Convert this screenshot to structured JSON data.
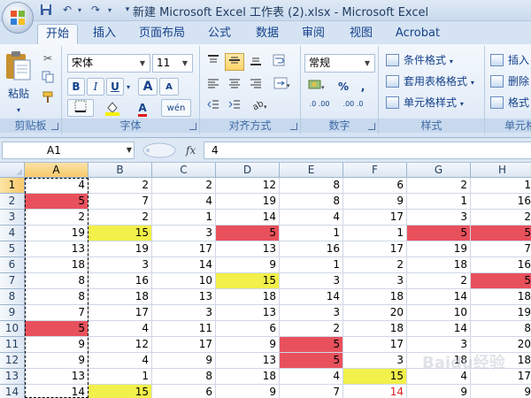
{
  "window": {
    "title": "新建 Microsoft Excel 工作表 (2).xlsx - Microsoft Excel"
  },
  "tabs": [
    {
      "label": "开始",
      "active": true
    },
    {
      "label": "插入",
      "active": false
    },
    {
      "label": "页面布局",
      "active": false
    },
    {
      "label": "公式",
      "active": false
    },
    {
      "label": "数据",
      "active": false
    },
    {
      "label": "审阅",
      "active": false
    },
    {
      "label": "视图",
      "active": false
    },
    {
      "label": "Acrobat",
      "active": false
    }
  ],
  "ribbon": {
    "clipboard": {
      "paste_label": "粘贴",
      "group_label": "剪贴板"
    },
    "font": {
      "font_name": "宋体",
      "font_size": "11",
      "bold": "B",
      "italic": "I",
      "underline": "U",
      "grow": "A",
      "shrink": "A",
      "font_color_glyph": "A",
      "phonetic": "wén",
      "group_label": "字体"
    },
    "alignment": {
      "group_label": "对齐方式"
    },
    "number": {
      "format": "常规",
      "percent": "%",
      "comma": ",",
      "inc_dec": ".0 .00",
      "dec_dec": ".00 .0",
      "group_label": "数字"
    },
    "styles": {
      "conditional": "条件格式",
      "table": "套用表格格式",
      "cell": "单元格样式",
      "group_label": "样式"
    },
    "cells": {
      "insert": "插入",
      "delete": "删除",
      "format": "格式",
      "group_label": "单元格"
    }
  },
  "formula_bar": {
    "name_box": "A1",
    "fx": "fx",
    "value": "4"
  },
  "sheet": {
    "columns": [
      "A",
      "B",
      "C",
      "D",
      "E",
      "F",
      "G",
      "H"
    ],
    "rows": [
      {
        "n": "1",
        "cells": [
          "4",
          "2",
          "2",
          "12",
          "8",
          "6",
          "2",
          "1"
        ]
      },
      {
        "n": "2",
        "cells": [
          "5",
          "7",
          "4",
          "19",
          "8",
          "9",
          "1",
          "16"
        ]
      },
      {
        "n": "3",
        "cells": [
          "2",
          "2",
          "1",
          "14",
          "4",
          "17",
          "3",
          "2"
        ]
      },
      {
        "n": "4",
        "cells": [
          "19",
          "15",
          "3",
          "5",
          "1",
          "1",
          "5",
          "5"
        ]
      },
      {
        "n": "5",
        "cells": [
          "13",
          "19",
          "17",
          "13",
          "16",
          "17",
          "19",
          "7"
        ]
      },
      {
        "n": "6",
        "cells": [
          "18",
          "3",
          "14",
          "9",
          "1",
          "2",
          "18",
          "16"
        ]
      },
      {
        "n": "7",
        "cells": [
          "8",
          "16",
          "10",
          "15",
          "3",
          "3",
          "2",
          "5"
        ]
      },
      {
        "n": "8",
        "cells": [
          "8",
          "18",
          "13",
          "18",
          "14",
          "18",
          "14",
          "18"
        ]
      },
      {
        "n": "9",
        "cells": [
          "7",
          "17",
          "3",
          "13",
          "3",
          "20",
          "10",
          "19"
        ]
      },
      {
        "n": "10",
        "cells": [
          "5",
          "4",
          "11",
          "6",
          "2",
          "18",
          "14",
          "8"
        ]
      },
      {
        "n": "11",
        "cells": [
          "9",
          "12",
          "17",
          "9",
          "5",
          "17",
          "3",
          "20"
        ]
      },
      {
        "n": "12",
        "cells": [
          "9",
          "4",
          "9",
          "13",
          "5",
          "3",
          "18",
          "18"
        ]
      },
      {
        "n": "13",
        "cells": [
          "13",
          "1",
          "8",
          "18",
          "4",
          "15",
          "4",
          "17"
        ]
      },
      {
        "n": "14",
        "cells": [
          "14",
          "15",
          "6",
          "9",
          "7",
          "14",
          "9",
          "9"
        ]
      }
    ],
    "highlights": {
      "red": [
        "A2",
        "D4",
        "G4",
        "H4",
        "H7",
        "A10",
        "E11",
        "E12"
      ],
      "yellow": [
        "B4",
        "D7",
        "F13",
        "B14"
      ],
      "red_text": [
        "F14"
      ]
    },
    "colors": {
      "red_fill": "#e8515c",
      "yellow_fill": "#f2f04a",
      "selection_header": "#f7c96b"
    }
  },
  "watermark": {
    "text": "Baidu经验"
  }
}
